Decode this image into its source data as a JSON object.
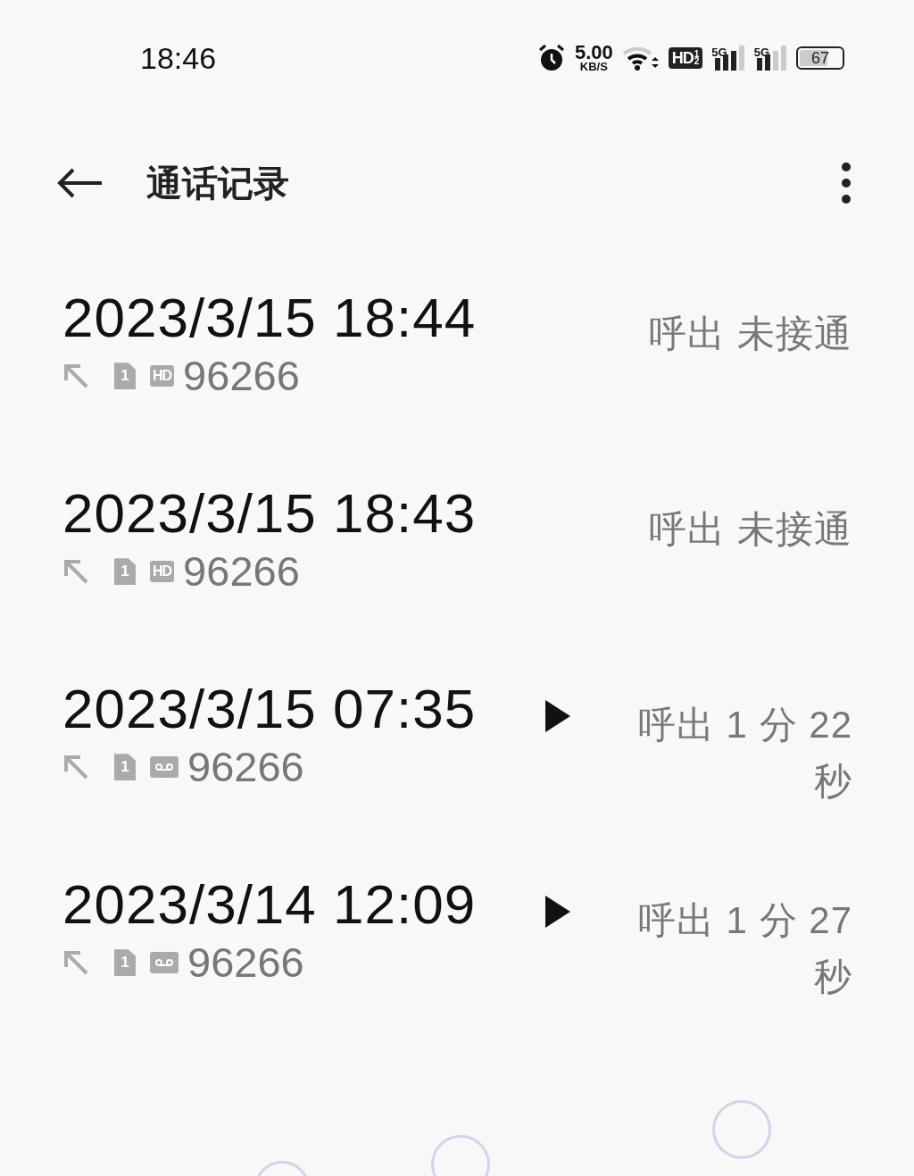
{
  "status_bar": {
    "time": "18:46",
    "speed": "5.00",
    "speed_unit": "KB/S",
    "hd": "HD",
    "hd_sup": "1",
    "hd_sub": "2",
    "sim1_network": "5G",
    "sim2_network": "5G",
    "battery": "67"
  },
  "header": {
    "title": "通话记录"
  },
  "calls": [
    {
      "datetime": "2023/3/15 18:44",
      "has_recording": false,
      "sim": "1",
      "line": {
        "kind": "hd",
        "label": "HD"
      },
      "number": "96266",
      "status": "呼出 未接通"
    },
    {
      "datetime": "2023/3/15 18:43",
      "has_recording": false,
      "sim": "1",
      "line": {
        "kind": "hd",
        "label": "HD"
      },
      "number": "96266",
      "status": "呼出 未接通"
    },
    {
      "datetime": "2023/3/15 07:35",
      "has_recording": true,
      "sim": "1",
      "line": {
        "kind": "voicemail"
      },
      "number": "96266",
      "status": "呼出 1 分 22 秒"
    },
    {
      "datetime": "2023/3/14 12:09",
      "has_recording": true,
      "sim": "1",
      "line": {
        "kind": "voicemail"
      },
      "number": "96266",
      "status": "呼出 1 分 27 秒"
    }
  ]
}
